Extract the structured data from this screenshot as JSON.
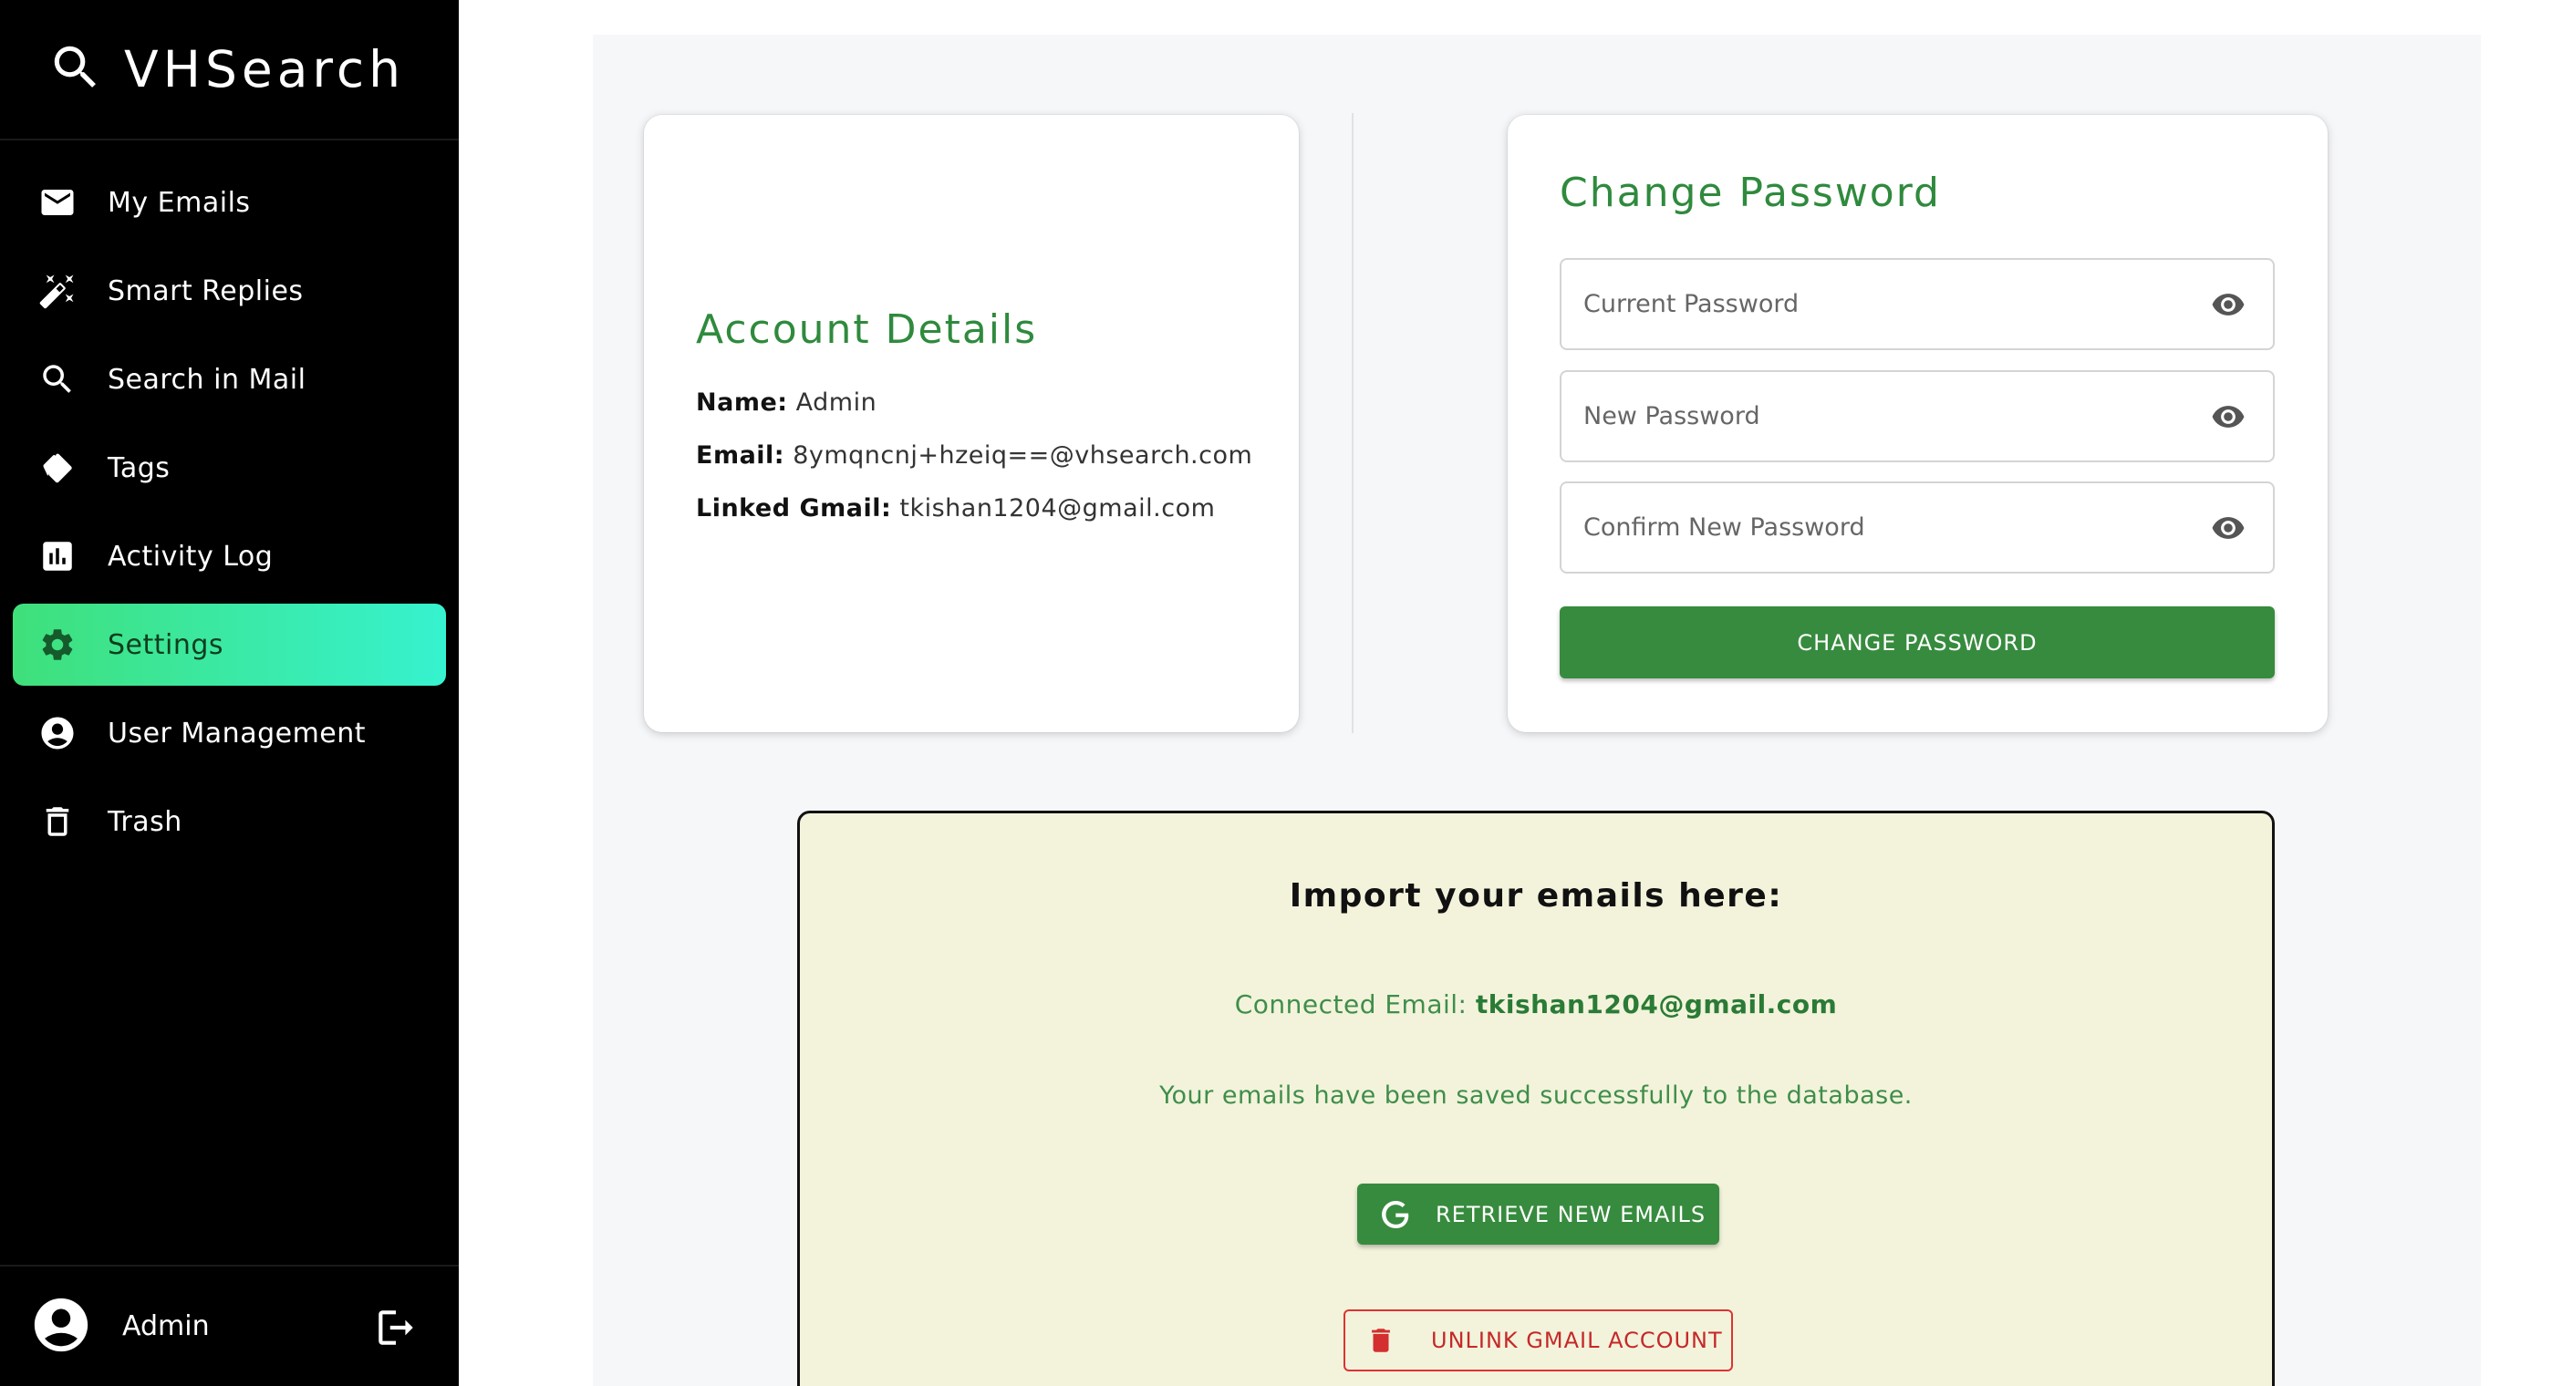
{
  "app": {
    "name": "VHSearch"
  },
  "sidebar": {
    "items": [
      {
        "label": "My Emails",
        "icon": "mail-icon"
      },
      {
        "label": "Smart Replies",
        "icon": "magic-wand-icon"
      },
      {
        "label": "Search in Mail",
        "icon": "search-icon"
      },
      {
        "label": "Tags",
        "icon": "tags-icon"
      },
      {
        "label": "Activity Log",
        "icon": "bar-chart-icon"
      },
      {
        "label": "Settings",
        "icon": "gear-icon",
        "active": true
      },
      {
        "label": "User Management",
        "icon": "account-circle-icon"
      },
      {
        "label": "Trash",
        "icon": "trash-icon"
      }
    ],
    "user": {
      "name": "Admin"
    }
  },
  "account": {
    "title": "Account Details",
    "name_key": "Name:",
    "name_value": "Admin",
    "email_key": "Email:",
    "email_value": "8ymqncnj+hzeiq==@vhsearch.com",
    "gmail_key": "Linked Gmail:",
    "gmail_value": "tkishan1204@gmail.com"
  },
  "password": {
    "title": "Change Password",
    "current_placeholder": "Current Password",
    "new_placeholder": "New Password",
    "confirm_placeholder": "Confirm New Password",
    "button_label": "CHANGE PASSWORD"
  },
  "import": {
    "title": "Import your emails here:",
    "connected_prefix": "Connected Email:",
    "connected_email": "tkishan1204@gmail.com",
    "saved_message": "Your emails have been saved successfully to the database.",
    "retrieve_label": "RETRIEVE NEW EMAILS",
    "unlink_label": "UNLINK GMAIL ACCOUNT"
  },
  "colors": {
    "accent_green": "#378b3e",
    "title_green": "#2f8a3d",
    "active_gradient_start": "#3fe07a",
    "active_gradient_end": "#36f2cf",
    "danger_red": "#d32f2f",
    "import_bg": "#f3f3dc"
  }
}
